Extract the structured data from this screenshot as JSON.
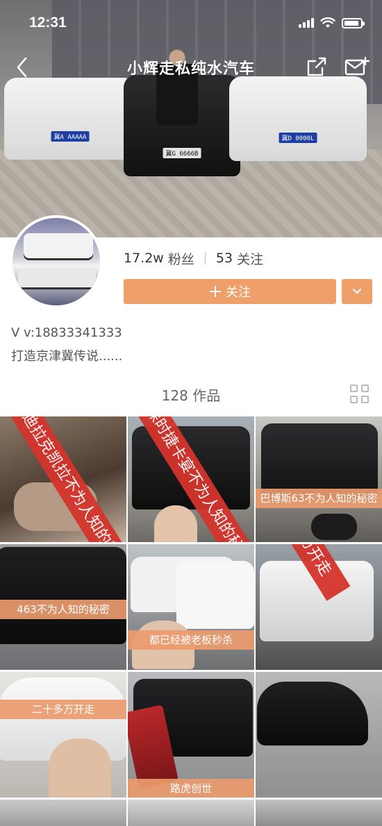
{
  "status_bar": {
    "time": "12:31",
    "battery_level": 0.9
  },
  "nav": {
    "title": "小辉走私纯水汽车"
  },
  "cover": {
    "plates": [
      "冀A AAAAA",
      "冀G 6666B",
      "冀D 0000L"
    ]
  },
  "profile": {
    "followers_count": "17.2w",
    "followers_label": "粉丝",
    "following_count": "53",
    "following_label": "关注",
    "follow_button_label": "关注",
    "bio_line1": "V v:18833341333",
    "bio_line2": "打造京津冀传说......"
  },
  "works": {
    "count_label": "128 作品"
  },
  "tiles": [
    {
      "ribbon": "凯迪拉克凯拉不为人知的秘",
      "caption": ""
    },
    {
      "ribbon": "保时捷卡宴不为人知的秘",
      "caption": ""
    },
    {
      "ribbon": "",
      "caption": "巴博斯63不为人知的秘密"
    },
    {
      "ribbon": "",
      "caption": "463不为人知的秘密"
    },
    {
      "ribbon": "",
      "caption": "都已经被老板秒杀"
    },
    {
      "ribbon": "万开走",
      "caption": ""
    },
    {
      "ribbon": "",
      "caption": "二十多万开走"
    },
    {
      "ribbon": "",
      "caption": "路虎创世"
    },
    {
      "ribbon": "",
      "caption": ""
    }
  ],
  "colors": {
    "accent": "#ee9f6a",
    "ribbon": "#d4342c",
    "caption_bg": "#eb9b6e"
  }
}
